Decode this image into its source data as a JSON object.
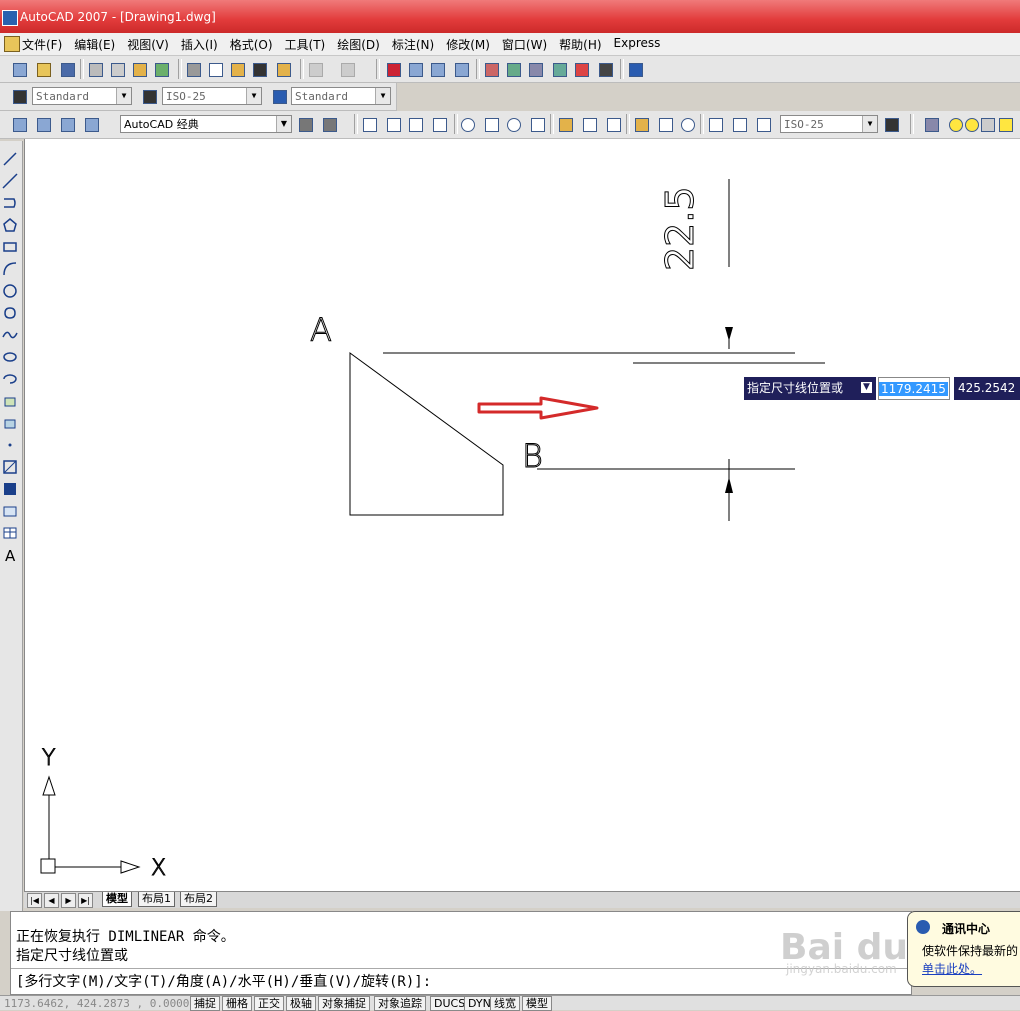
{
  "window": {
    "title": "AutoCAD 2007 - [Drawing1.dwg]"
  },
  "menu": {
    "items": [
      "文件(F)",
      "编辑(E)",
      "视图(V)",
      "插入(I)",
      "格式(O)",
      "工具(T)",
      "绘图(D)",
      "标注(N)",
      "修改(M)",
      "窗口(W)",
      "帮助(H)",
      "Express"
    ]
  },
  "styles_toolbar": {
    "text_style": "Standard",
    "dim_style": "ISO-25",
    "table_style": "Standard"
  },
  "workspace_toolbar": {
    "workspace": "AutoCAD 经典",
    "dim_style": "ISO-25"
  },
  "drawing": {
    "label_a": "A",
    "label_b": "B",
    "dim_text": "22.5",
    "ucs_x": "X",
    "ucs_y": "Y"
  },
  "dynamic_input": {
    "prompt": "指定尺寸线位置或",
    "x_value": "1179.2415",
    "y_value": "425.2542"
  },
  "layout_tabs": [
    "模型",
    "布局1",
    "布局2"
  ],
  "command_window": {
    "line1": "正在恢复执行 DIMLINEAR 命令。",
    "line2": "指定尺寸线位置或",
    "prompt": "[多行文字(M)/文字(T)/角度(A)/水平(H)/垂直(V)/旋转(R)]:"
  },
  "status_bar": {
    "coords": "1173.6462, 424.2873 , 0.0000",
    "buttons": [
      "捕捉",
      "栅格",
      "正交",
      "极轴",
      "对象捕捉",
      "对象追踪",
      "DUCS",
      "DYN",
      "线宽",
      "模型"
    ]
  },
  "notification": {
    "title": "通讯中心",
    "body": "使软件保持最新的",
    "link": "单击此处。"
  },
  "watermark": {
    "brand": "Bai du 经验",
    "url": "jingyan.baidu.com"
  },
  "colors": {
    "title_bar": "#e23b3b",
    "arrow": "#d42a2a",
    "dyn_bg": "#1f1f5a"
  }
}
